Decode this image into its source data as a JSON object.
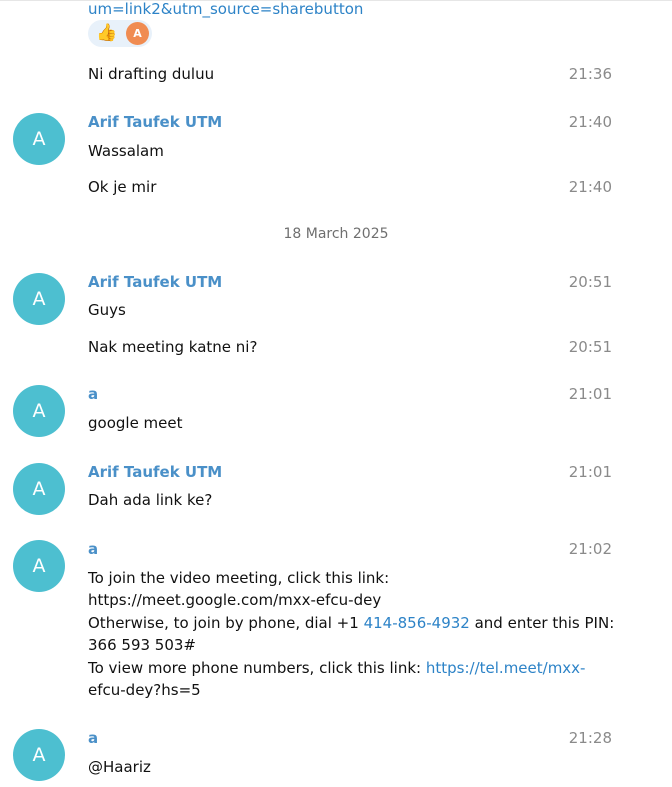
{
  "top_link": "um=link2&utm_source=sharebutton",
  "reaction": {
    "emoji": "👍",
    "reactor_initial": "A"
  },
  "date_separator": "18 March 2025",
  "msg": {
    "m1": {
      "text": "Ni drafting duluu",
      "time": "21:36"
    },
    "m2": {
      "sender": "Arif Taufek UTM",
      "avatar": "A",
      "time": "21:40",
      "text": "Wassalam"
    },
    "m3": {
      "text": "Ok je mir",
      "time": "21:40"
    },
    "m4": {
      "sender": "Arif Taufek UTM",
      "avatar": "A",
      "time": "20:51",
      "text": "Guys"
    },
    "m5": {
      "text": "Nak meeting katne ni?",
      "time": "20:51"
    },
    "m6": {
      "sender": "a",
      "avatar": "A",
      "time": "21:01",
      "text": "google meet"
    },
    "m7": {
      "sender": "Arif Taufek UTM",
      "avatar": "A",
      "time": "21:01",
      "text": "Dah ada link ke?"
    },
    "m8": {
      "sender": "a",
      "avatar": "A",
      "time": "21:02",
      "line1": "To join the video meeting, click this link:",
      "link1": "https://meet.google.com/mxx-efcu-dey",
      "line3_a": "Otherwise, to join by phone, dial +1 ",
      "phone": "414-856-4932",
      "line3_b": " and enter this PIN:",
      "pin": "366 593 503#",
      "line5": "To view more phone numbers, click this link: ",
      "link2_a": "https://tel.meet/mxx-",
      "link2_b": "efcu-dey?hs=5"
    },
    "m9": {
      "sender": "a",
      "avatar": "A",
      "time": "21:28",
      "text": "@Haariz"
    }
  }
}
